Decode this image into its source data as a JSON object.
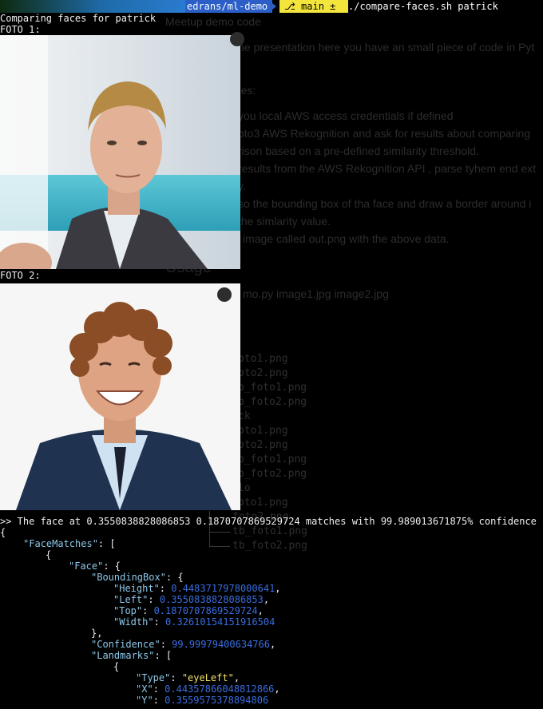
{
  "prompt": {
    "path": "edrans/ml-demo",
    "branch": " main ±✚",
    "command": "./compare-faces.sh patrick"
  },
  "background_doc": {
    "title": "Meetup demo code",
    "intro": "he presentation here you have an small piece of code in Pyt",
    "does": " does:",
    "bullets": [
      "you local AWS access credentials if defined",
      "oto3 AWS Rekognition and ask for results about comparing",
      "rison based on a pre-defined similarity threshold.",
      "results from the AWS Rekognition API , parse tyhem end ext",
      "y.",
      "so the bounding box of tha face and draw a border around i",
      "the simlarity value.",
      "image called out.png with the above data."
    ],
    "usage": "Usage",
    "usage_cmd": "mo.py image1.jpg image2.jpg",
    "files": [
      "oto1.png",
      "oto2.png",
      "b_foto1.png",
      "b_foto2.png",
      "ck",
      "oto1.png",
      "oto2.png",
      "b_foto1.png",
      "b_foto2.png",
      "lo",
      "oto1.png",
      "foto2.png",
      "tb_foto1.png",
      "tb_foto2.png"
    ]
  },
  "header": {
    "comparing": "Comparing faces for patrick",
    "foto1": "FOTO 1:",
    "foto2": "FOTO 2:"
  },
  "result_line": ">> The face at 0.3550838828086853 0.1870707869529724 matches with 99.989013671875% confidence",
  "json_output": {
    "open": "{",
    "face_matches_key": "\"FaceMatches\"",
    "arr_open": ": [",
    "obj_open": "{",
    "face_key": "\"Face\"",
    "face_open": ": {",
    "bbox_key": "\"BoundingBox\"",
    "bbox_open": ": {",
    "height_key": "\"Height\"",
    "height_val": "0.4483717978000641",
    "left_key": "\"Left\"",
    "left_val": "0.3550838828086853",
    "top_key": "\"Top\"",
    "top_val": "0.1870707869529724",
    "width_key": "\"Width\"",
    "width_val": "0.32610154151916504",
    "bbox_close": "},",
    "confidence_key": "\"Confidence\"",
    "confidence_val": "99.99979400634766",
    "landmarks_key": "\"Landmarks\"",
    "landmarks_open": ": [",
    "lm_open": "{",
    "type_key": "\"Type\"",
    "type_val": "\"eyeLeft\"",
    "x_key": "\"X\"",
    "x_val": "0.44357866048812866",
    "y_key": "\"Y\"",
    "y_val": "0.3559575378894806",
    "lm_close": "},"
  }
}
